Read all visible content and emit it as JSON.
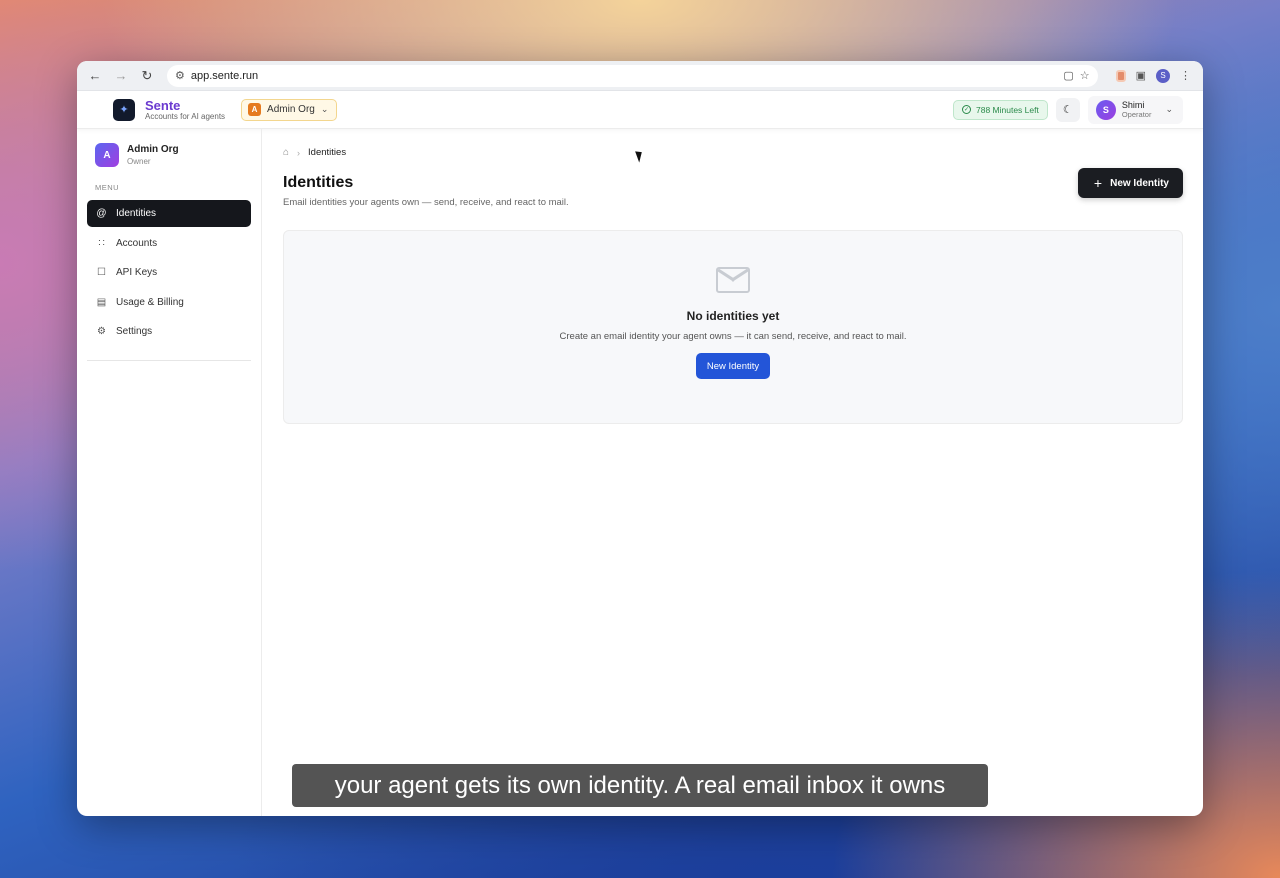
{
  "browser": {
    "url": "app.sente.run",
    "profile_initial": "S"
  },
  "header": {
    "brand_name": "Sente",
    "brand_tagline": "Accounts for AI agents",
    "org_badge": "A",
    "org_name": "Admin Org",
    "minutes_left": "788 Minutes Left",
    "user_initial": "S",
    "user_name": "Shimi",
    "user_role": "Operator"
  },
  "sidebar": {
    "org_initial": "A",
    "org_name": "Admin Org",
    "org_role": "Owner",
    "menu_label": "MENU",
    "items": [
      {
        "label": "Identities",
        "icon": "at-icon",
        "active": true
      },
      {
        "label": "Accounts",
        "icon": "grid-icon",
        "active": false
      },
      {
        "label": "API Keys",
        "icon": "lock-icon",
        "active": false
      },
      {
        "label": "Usage & Billing",
        "icon": "credit-card-icon",
        "active": false
      },
      {
        "label": "Settings",
        "icon": "gear-icon",
        "active": false
      }
    ]
  },
  "main": {
    "breadcrumb_current": "Identities",
    "title": "Identities",
    "subtitle": "Email identities your agents own — send, receive, and react to mail.",
    "new_button_label": "New Identity",
    "empty_title": "No identities yet",
    "empty_description": "Create an email identity your agent owns — it can send, receive, and react to mail.",
    "empty_button_label": "New Identity"
  },
  "caption": "your agent gets its own identity. A real email inbox it owns",
  "colors": {
    "brand": "#6b3ad0",
    "active_nav": "#15171c",
    "primary_blue": "#2355d8",
    "minutes_green": "#2a8a4a"
  }
}
